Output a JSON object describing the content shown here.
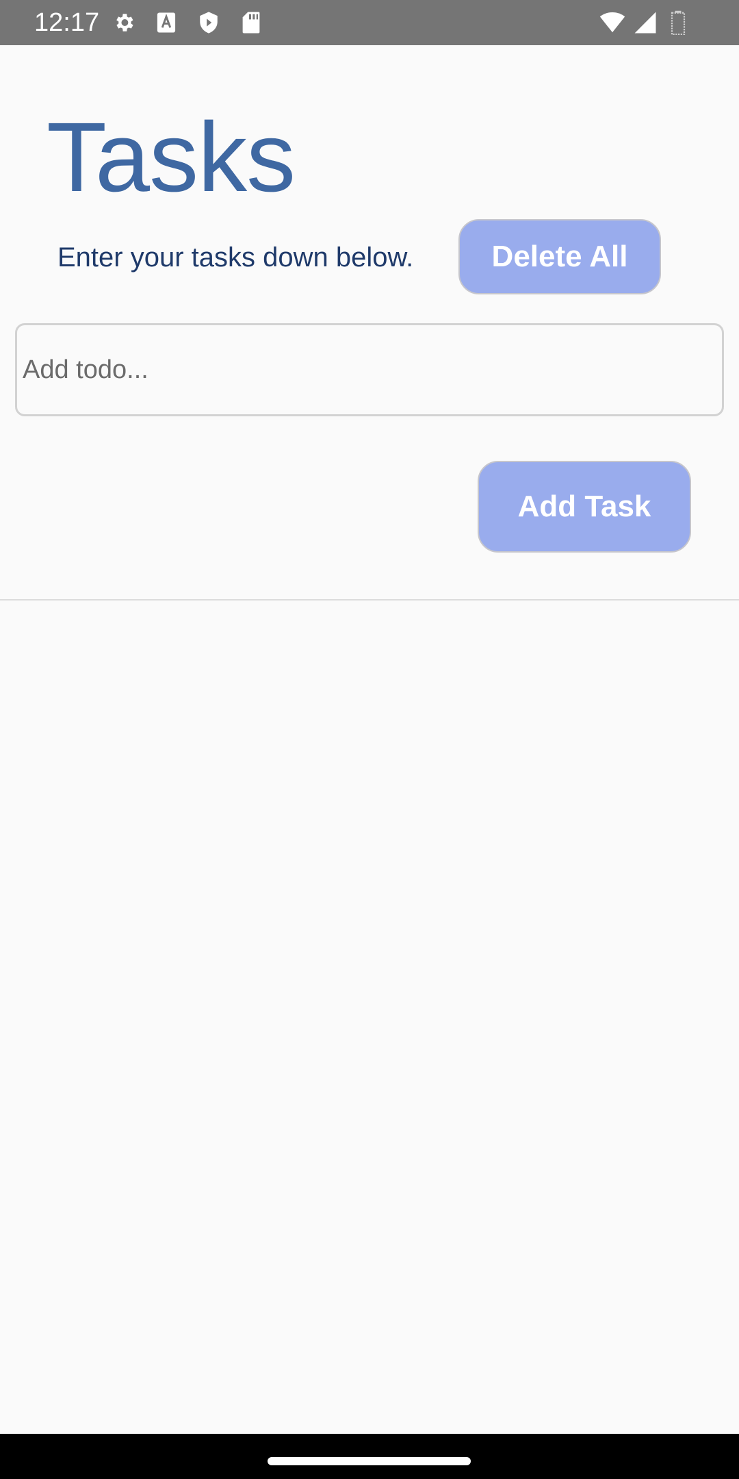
{
  "status_bar": {
    "time": "12:17",
    "left_icons": [
      "gear-icon",
      "font-a-icon",
      "shield-icon",
      "sd-card-icon"
    ],
    "right_icons": [
      "wifi-icon",
      "cell-signal-icon",
      "battery-icon"
    ]
  },
  "header": {
    "title": "Tasks",
    "subtitle": "Enter your tasks down below."
  },
  "actions": {
    "delete_all_label": "Delete All",
    "add_task_label": "Add Task"
  },
  "todo_input": {
    "placeholder": "Add todo...",
    "value": ""
  },
  "colors": {
    "status_bar_bg": "#757575",
    "title": "#3f68a2",
    "subtitle": "#1f3a6a",
    "button_bg": "#99aced",
    "button_text": "#ffffff",
    "page_bg": "#fafafa"
  }
}
